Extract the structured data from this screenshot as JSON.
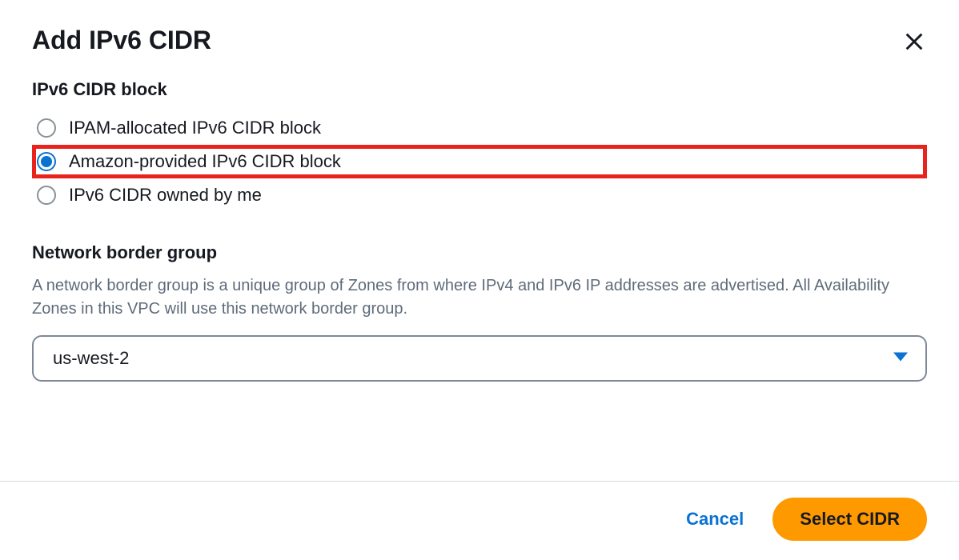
{
  "modal": {
    "title": "Add IPv6 CIDR"
  },
  "cidr_block": {
    "label": "IPv6 CIDR block",
    "options": [
      {
        "label": "IPAM-allocated IPv6 CIDR block",
        "selected": false,
        "highlighted": false
      },
      {
        "label": "Amazon-provided IPv6 CIDR block",
        "selected": true,
        "highlighted": true
      },
      {
        "label": "IPv6 CIDR owned by me",
        "selected": false,
        "highlighted": false
      }
    ]
  },
  "network_border_group": {
    "label": "Network border group",
    "description": "A network border group is a unique group of Zones from where IPv4 and IPv6 IP addresses are advertised. All Availability Zones in this VPC will use this network border group.",
    "selected_value": "us-west-2"
  },
  "footer": {
    "cancel_label": "Cancel",
    "submit_label": "Select CIDR"
  }
}
